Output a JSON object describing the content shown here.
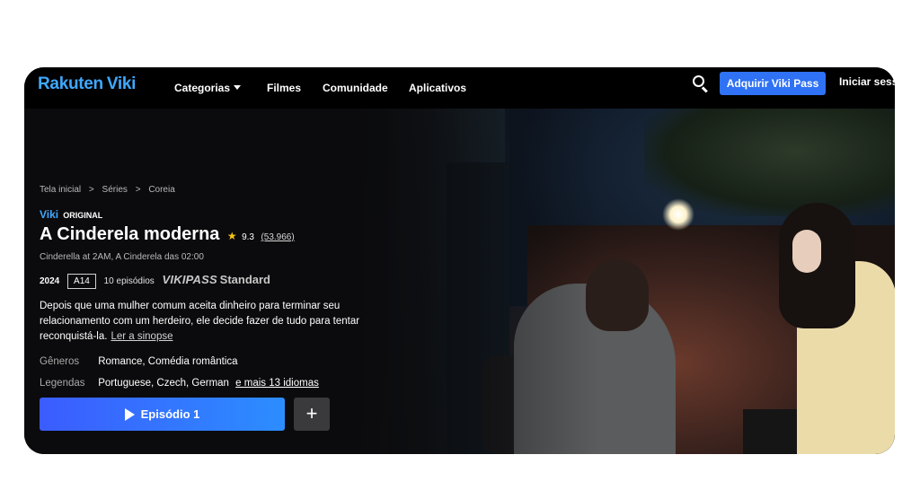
{
  "nav": {
    "logo_rakuten": "Rakuten",
    "logo_viki": "Viki",
    "links": [
      "Categorias",
      "Filmes",
      "Comunidade",
      "Aplicativos"
    ],
    "vikipass_button": "Adquirir Viki Pass",
    "login": "Iniciar sess",
    "search_icon": "search-icon"
  },
  "breadcrumb": [
    "Tela inicial",
    "Séries",
    "Coreia"
  ],
  "badge": {
    "brand": "Viki",
    "label": "ORIGINAL"
  },
  "show": {
    "title": "A Cinderela moderna",
    "rating": "9.3",
    "votes": "(53.966)",
    "alt_titles": "Cinderella at 2AM, A Cinderela das 02:00",
    "year": "2024",
    "age_rating": "A14",
    "episodes": "10 episódios",
    "tier_brand": "VIKIPASS",
    "tier_label": "Standard",
    "synopsis": "Depois que uma mulher comum aceita dinheiro para terminar seu relacionamento com um herdeiro, ele decide fazer de tudo para tentar reconquistá-la.",
    "synopsis_link": "Ler a sinopse",
    "genres_label": "Gêneros",
    "genres": "Romance, Comédia romântica",
    "subtitles_label": "Legendas",
    "subtitles": "Portuguese, Czech, German",
    "subtitles_more": "e mais 13 idiomas"
  },
  "actions": {
    "play": "Episódio 1",
    "add": "+"
  },
  "colors": {
    "accent": "#2f72f5",
    "logo": "#3fa8ff",
    "star": "#f5c518",
    "background": "#0b0b0d"
  }
}
